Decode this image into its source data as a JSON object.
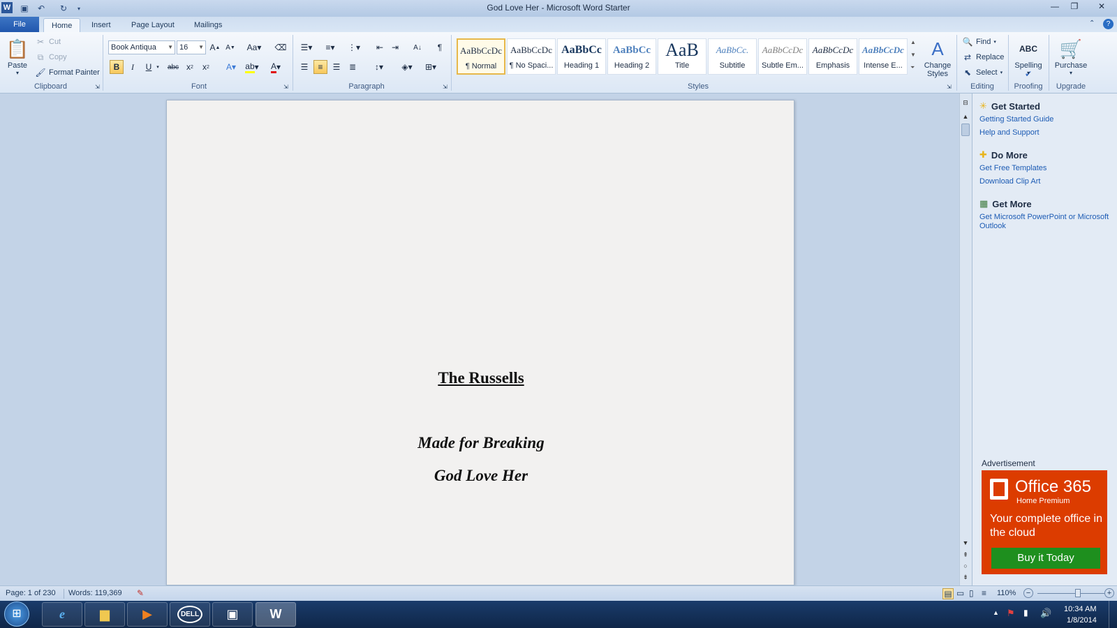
{
  "window": {
    "title": "God Love Her - Microsoft Word Starter"
  },
  "tabs": {
    "file": "File",
    "home": "Home",
    "insert": "Insert",
    "page_layout": "Page Layout",
    "mailings": "Mailings"
  },
  "clipboard": {
    "paste": "Paste",
    "cut": "Cut",
    "copy": "Copy",
    "format_painter": "Format Painter",
    "group": "Clipboard"
  },
  "font": {
    "family": "Book Antiqua",
    "size": "16",
    "group": "Font"
  },
  "paragraph": {
    "group": "Paragraph"
  },
  "styles": {
    "group": "Styles",
    "items": [
      {
        "sample": "AaBbCcDc",
        "name": "¶ Normal"
      },
      {
        "sample": "AaBbCcDc",
        "name": "¶ No Spaci..."
      },
      {
        "sample": "AaBbCc",
        "name": "Heading 1"
      },
      {
        "sample": "AaBbCc",
        "name": "Heading 2"
      },
      {
        "sample": "AaB",
        "name": "Title"
      },
      {
        "sample": "AaBbCc.",
        "name": "Subtitle"
      },
      {
        "sample": "AaBbCcDc",
        "name": "Subtle Em..."
      },
      {
        "sample": "AaBbCcDc",
        "name": "Emphasis"
      },
      {
        "sample": "AaBbCcDc",
        "name": "Intense E..."
      }
    ],
    "change_line1": "Change",
    "change_line2": "Styles"
  },
  "editing": {
    "find": "Find",
    "replace": "Replace",
    "select": "Select",
    "group": "Editing"
  },
  "proofing": {
    "spelling": "Spelling",
    "group": "Proofing"
  },
  "upgrade": {
    "purchase": "Purchase",
    "group": "Upgrade"
  },
  "document": {
    "title": "The Russells",
    "line1": "Made for Breaking",
    "line2": "God Love Her"
  },
  "pane": {
    "get_started": "Get Started",
    "getting_started_guide": "Getting Started Guide",
    "help_support": "Help and Support",
    "do_more": "Do More",
    "free_templates": "Get Free Templates",
    "clip_art": "Download Clip Art",
    "get_more": "Get More",
    "get_more_link": "Get Microsoft PowerPoint or Microsoft Outlook",
    "ad_label": "Advertisement",
    "ad_brand": "Office 365",
    "ad_sub": "Home Premium",
    "ad_tagline": "Your complete office in the cloud",
    "ad_button": "Buy it Today"
  },
  "status": {
    "page": "Page: 1 of 230",
    "words": "Words: 119,369",
    "zoom": "110%",
    "zoom_fraction": 0.6
  },
  "taskbar": {
    "time": "10:34 AM",
    "date": "1/8/2014",
    "dell": "DELL"
  },
  "colors": {
    "office_red": "#dc3c00",
    "buy_green": "#1e8f1e",
    "link_blue": "#1c5bb4"
  }
}
